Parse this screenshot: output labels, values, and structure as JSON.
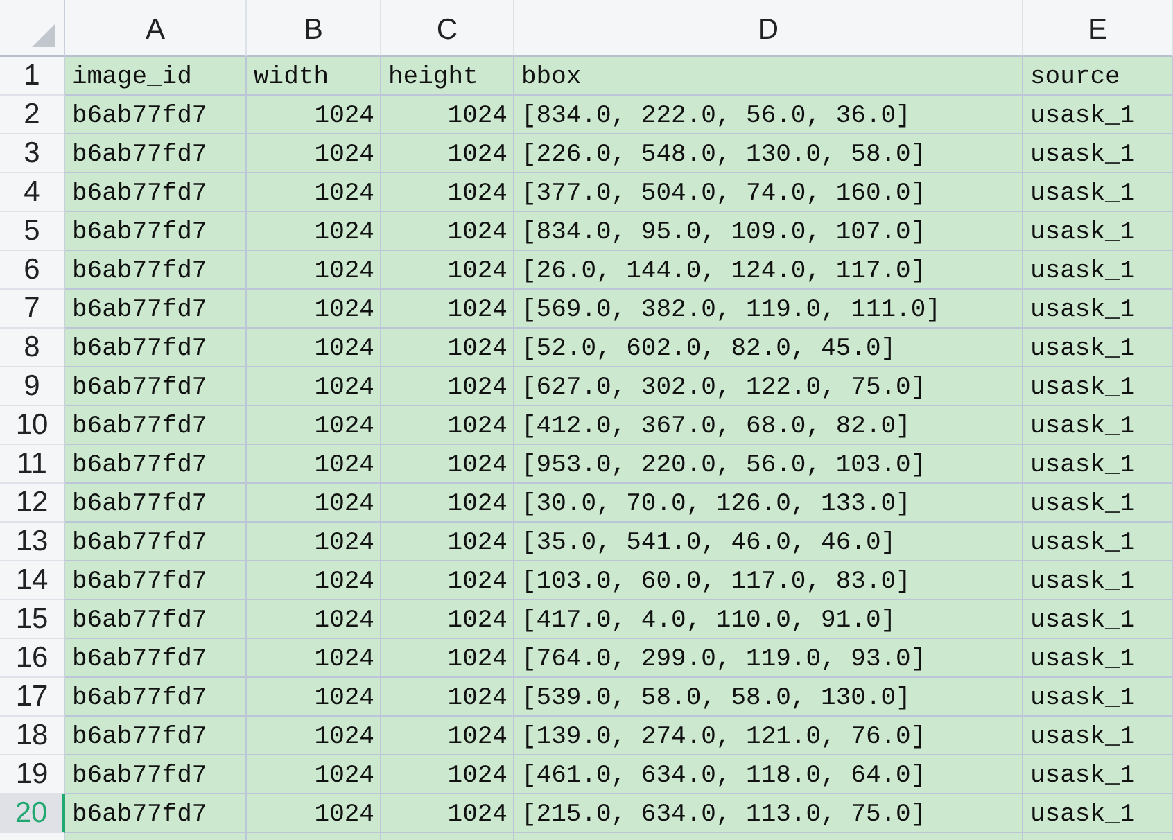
{
  "sheet": {
    "columns": [
      {
        "label": "A",
        "kind": "text"
      },
      {
        "label": "B",
        "kind": "number"
      },
      {
        "label": "C",
        "kind": "number"
      },
      {
        "label": "D",
        "kind": "text"
      },
      {
        "label": "E",
        "kind": "text"
      }
    ],
    "header_row": {
      "number": "1",
      "selected": false,
      "cells": [
        "image_id",
        "width",
        "height",
        "bbox",
        "source"
      ]
    },
    "rows": [
      {
        "number": "2",
        "selected": false,
        "cells": [
          "b6ab77fd7",
          "1024",
          "1024",
          "[834.0, 222.0, 56.0, 36.0]",
          "usask_1"
        ]
      },
      {
        "number": "3",
        "selected": false,
        "cells": [
          "b6ab77fd7",
          "1024",
          "1024",
          "[226.0, 548.0, 130.0, 58.0]",
          "usask_1"
        ]
      },
      {
        "number": "4",
        "selected": false,
        "cells": [
          "b6ab77fd7",
          "1024",
          "1024",
          "[377.0, 504.0, 74.0, 160.0]",
          "usask_1"
        ]
      },
      {
        "number": "5",
        "selected": false,
        "cells": [
          "b6ab77fd7",
          "1024",
          "1024",
          "[834.0, 95.0, 109.0, 107.0]",
          "usask_1"
        ]
      },
      {
        "number": "6",
        "selected": false,
        "cells": [
          "b6ab77fd7",
          "1024",
          "1024",
          "[26.0, 144.0, 124.0, 117.0]",
          "usask_1"
        ]
      },
      {
        "number": "7",
        "selected": false,
        "cells": [
          "b6ab77fd7",
          "1024",
          "1024",
          "[569.0, 382.0, 119.0, 111.0]",
          "usask_1"
        ]
      },
      {
        "number": "8",
        "selected": false,
        "cells": [
          "b6ab77fd7",
          "1024",
          "1024",
          "[52.0, 602.0, 82.0, 45.0]",
          "usask_1"
        ]
      },
      {
        "number": "9",
        "selected": false,
        "cells": [
          "b6ab77fd7",
          "1024",
          "1024",
          "[627.0, 302.0, 122.0, 75.0]",
          "usask_1"
        ]
      },
      {
        "number": "10",
        "selected": false,
        "cells": [
          "b6ab77fd7",
          "1024",
          "1024",
          "[412.0, 367.0, 68.0, 82.0]",
          "usask_1"
        ]
      },
      {
        "number": "11",
        "selected": false,
        "cells": [
          "b6ab77fd7",
          "1024",
          "1024",
          "[953.0, 220.0, 56.0, 103.0]",
          "usask_1"
        ]
      },
      {
        "number": "12",
        "selected": false,
        "cells": [
          "b6ab77fd7",
          "1024",
          "1024",
          "[30.0, 70.0, 126.0, 133.0]",
          "usask_1"
        ]
      },
      {
        "number": "13",
        "selected": false,
        "cells": [
          "b6ab77fd7",
          "1024",
          "1024",
          "[35.0, 541.0, 46.0, 46.0]",
          "usask_1"
        ]
      },
      {
        "number": "14",
        "selected": false,
        "cells": [
          "b6ab77fd7",
          "1024",
          "1024",
          "[103.0, 60.0, 117.0, 83.0]",
          "usask_1"
        ]
      },
      {
        "number": "15",
        "selected": false,
        "cells": [
          "b6ab77fd7",
          "1024",
          "1024",
          "[417.0, 4.0, 110.0, 91.0]",
          "usask_1"
        ]
      },
      {
        "number": "16",
        "selected": false,
        "cells": [
          "b6ab77fd7",
          "1024",
          "1024",
          "[764.0, 299.0, 119.0, 93.0]",
          "usask_1"
        ]
      },
      {
        "number": "17",
        "selected": false,
        "cells": [
          "b6ab77fd7",
          "1024",
          "1024",
          "[539.0, 58.0, 58.0, 130.0]",
          "usask_1"
        ]
      },
      {
        "number": "18",
        "selected": false,
        "cells": [
          "b6ab77fd7",
          "1024",
          "1024",
          "[139.0, 274.0, 121.0, 76.0]",
          "usask_1"
        ]
      },
      {
        "number": "19",
        "selected": false,
        "cells": [
          "b6ab77fd7",
          "1024",
          "1024",
          "[461.0, 634.0, 118.0, 64.0]",
          "usask_1"
        ]
      },
      {
        "number": "20",
        "selected": true,
        "cells": [
          "b6ab77fd7",
          "1024",
          "1024",
          "[215.0, 634.0, 113.0, 75.0]",
          "usask_1"
        ]
      }
    ]
  }
}
